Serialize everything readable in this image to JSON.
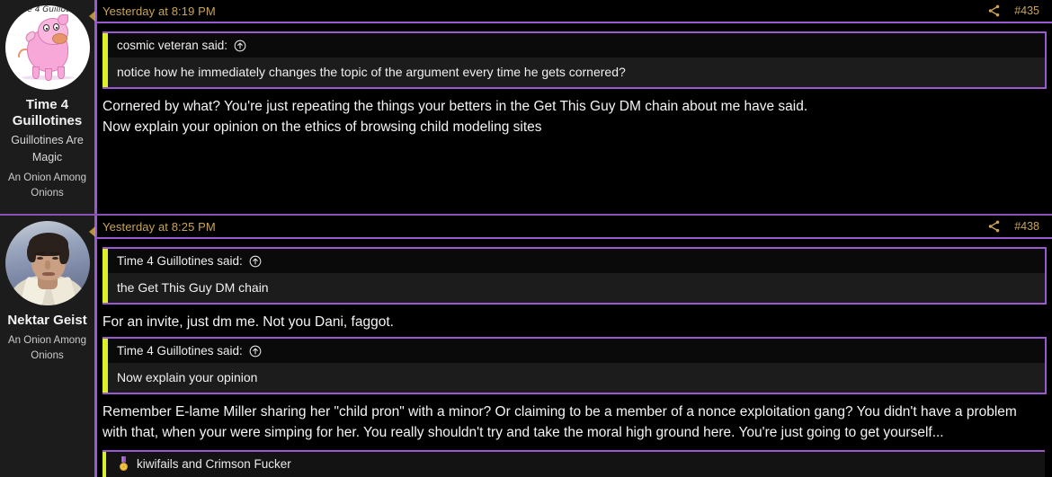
{
  "theme": {
    "accent_purple": "#9b59d0",
    "accent_yellow": "#dcf02a",
    "meta_gold": "#c8a558",
    "page_background": "#000000",
    "sidebar_background": "#1c1c1c",
    "text_color": "#f4f4f4"
  },
  "posts": [
    {
      "id": "post-435",
      "author": {
        "username": "Time 4 Guillotines",
        "custom_title": "Guillotines Are Magic",
        "user_group": "An Onion Among Onions",
        "avatar_type": "pig-illustration-avatar",
        "avatar_caption": "e 4 Guillotin"
      },
      "header": {
        "date": "Yesterday at 8:19 PM",
        "share_icon": "share-icon",
        "post_number": "#435"
      },
      "quotes": [
        {
          "author_line": "cosmic veteran said:",
          "jump_icon": "jump-to-post-icon",
          "text": "notice how he immediately changes the topic of the argument every time he gets cornered?"
        }
      ],
      "message_lines": [
        "Cornered by what? You're just repeating the things your betters in the Get This Guy DM chain about me have said.",
        "Now explain your opinion on the ethics of browsing child modeling sites"
      ],
      "reactions": null
    },
    {
      "id": "post-438",
      "author": {
        "username": "Nektar Geist",
        "custom_title": "",
        "user_group": "An Onion Among Onions",
        "avatar_type": "portrait-photo-avatar",
        "avatar_caption": ""
      },
      "header": {
        "date": "Yesterday at 8:25 PM",
        "share_icon": "share-icon",
        "post_number": "#438"
      },
      "quotes": [
        {
          "author_line": "Time 4 Guillotines said:",
          "jump_icon": "jump-to-post-icon",
          "text": "the Get This Guy DM chain"
        },
        {
          "author_line": "Time 4 Guillotines said:",
          "jump_icon": "jump-to-post-icon",
          "text": "Now explain your opinion"
        }
      ],
      "message_middle": "For an invite, just dm me. Not you Dani, faggot.",
      "message_final": "Remember E-lame Miller sharing her \"child pron\" with a minor? Or claiming to be a member of a nonce exploitation gang? You didn't have a problem with that, when your were simping for her. You really shouldn't try and take the moral high ground here. You're just going to get yourself...",
      "reactions": {
        "icon": "medal-emoji",
        "text": "kiwifails and Crimson Fucker"
      }
    }
  ]
}
